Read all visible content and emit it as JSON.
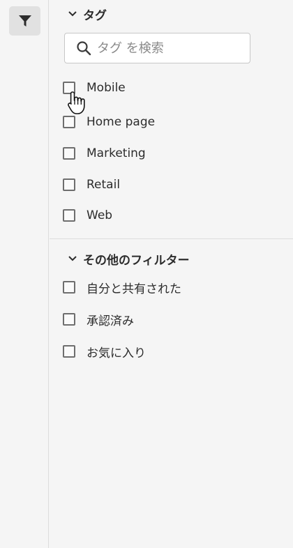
{
  "rail": {
    "filter_icon": "filter-funnel-icon"
  },
  "tags": {
    "title": "タグ",
    "search_placeholder": "タグ を検索",
    "items": [
      {
        "label": "Mobile",
        "checked": false
      },
      {
        "label": "Home page",
        "checked": false
      },
      {
        "label": "Marketing",
        "checked": false
      },
      {
        "label": "Retail",
        "checked": false
      },
      {
        "label": "Web",
        "checked": false
      }
    ]
  },
  "other_filters": {
    "title": "その他のフィルター",
    "items": [
      {
        "label": "自分と共有された",
        "checked": false
      },
      {
        "label": "承認済み",
        "checked": false
      },
      {
        "label": "お気に入り",
        "checked": false
      }
    ]
  },
  "colors": {
    "background": "#f5f5f5",
    "text": "#2c2c2c",
    "border": "#c7c7c7",
    "active_button": "#e1e1e1"
  }
}
